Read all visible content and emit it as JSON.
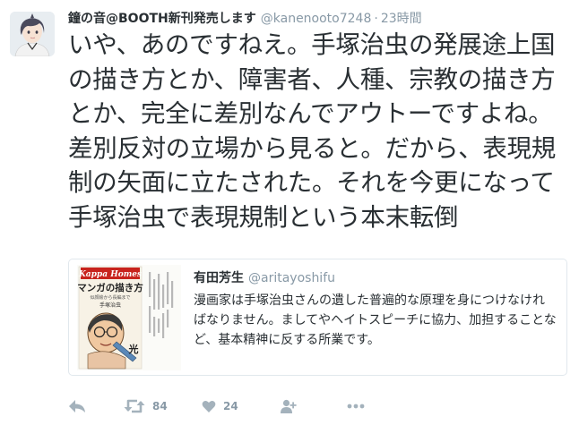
{
  "tweet": {
    "display_name": "鐘の音@BOOTH新刊発売します",
    "handle": "@kanenooto7248",
    "separator": "·",
    "time": "23時間",
    "text": "いや、あのですねえ。手塚治虫の発展途上国の描き方とか、障害者、人種、宗教の描き方とか、完全に差別なんでアウトーですよね。差別反対の立場から見ると。だから、表現規制の矢面に立たされた。それを今更になって手塚治虫で表現規制という本末転倒"
  },
  "quote": {
    "display_name": "有田芳生",
    "handle": "@aritayoshifu",
    "text": "漫画家は手塚治虫さんの遺した普遍的な原理を身につけなければなりません。ましてやヘイトスピーチに協力、加担することなど、基本精神に反する所業です。",
    "media": {
      "series": "Kappa Homes",
      "book_title": "マンガの描き方",
      "book_subtitle": "似顔絵から長編まで",
      "author": "手塚治虫",
      "publisher_mark": "光"
    }
  },
  "actions": {
    "reply_icon": "reply-icon",
    "retweet_icon": "retweet-icon",
    "retweet_count": "84",
    "like_icon": "heart-icon",
    "like_count": "24",
    "follow_icon": "follow-icon",
    "more_icon": "more-icon"
  },
  "colors": {
    "text": "#292f33",
    "muted": "#8899a6",
    "border": "#e1e8ed",
    "book_red": "#c8231d"
  }
}
